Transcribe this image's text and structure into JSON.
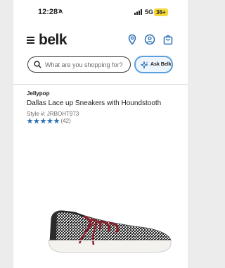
{
  "status_bar": {
    "time": "12:28",
    "network": "5G",
    "battery": "36+"
  },
  "header": {
    "logo": "belk"
  },
  "search": {
    "placeholder": "What are you shopping for?"
  },
  "ask_button": {
    "label": "Ask Belk"
  },
  "product": {
    "brand": "Jellypop",
    "title": "Dallas Lace up Sneakers with Houndstooth",
    "style": "Style #: JRBOHT973",
    "rating": 5,
    "review_count": "(42)"
  },
  "colors": {
    "accent_blue": "#2a6fb3",
    "ask_border": "#5aa0e0",
    "lace_red": "#8b1f2b"
  }
}
